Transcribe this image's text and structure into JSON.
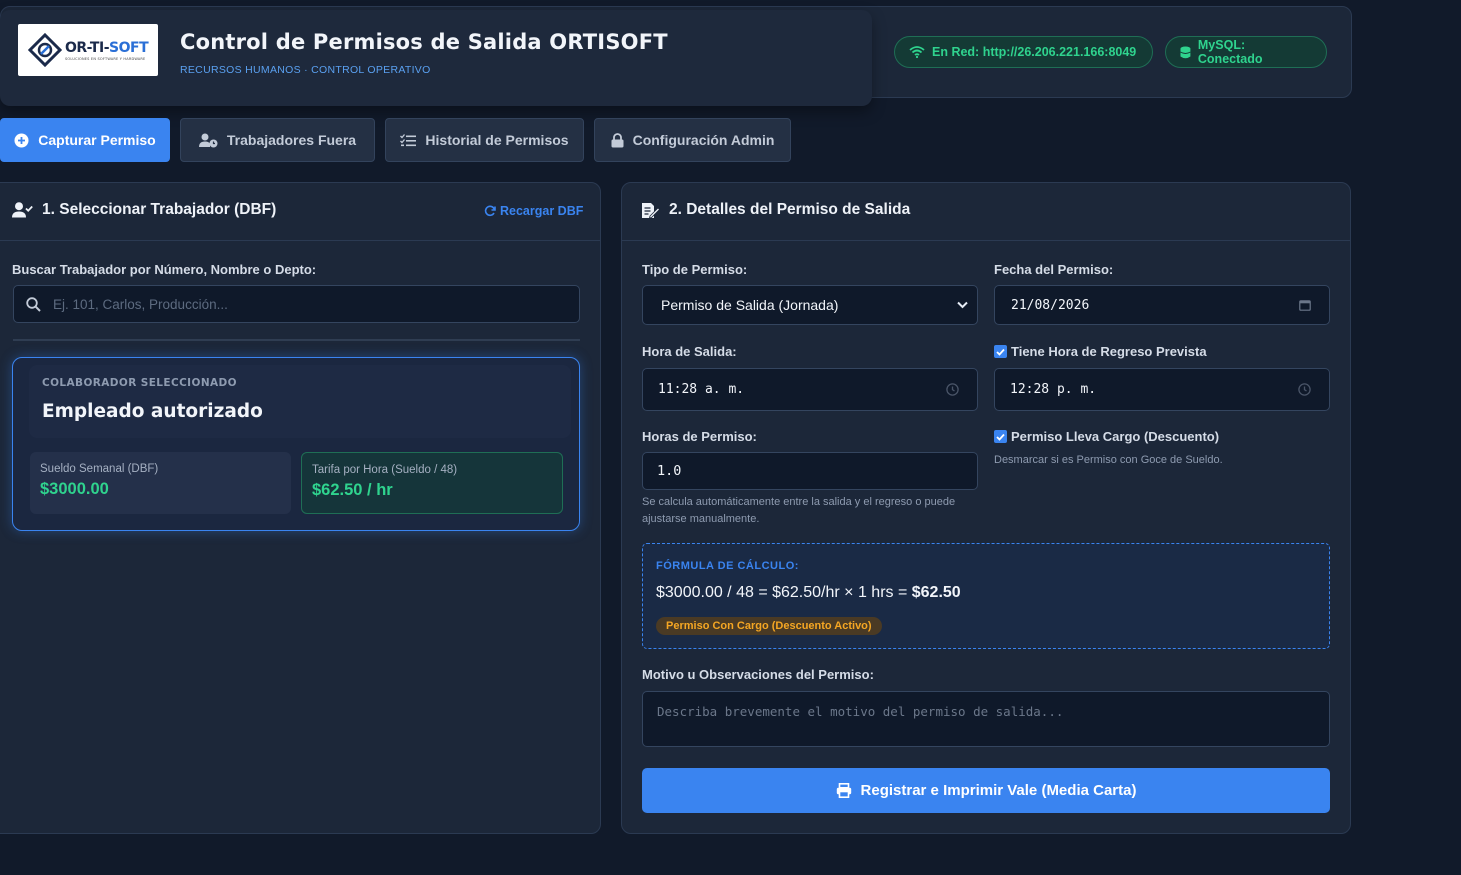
{
  "header": {
    "logo_brand_a": "OR-TI-",
    "logo_brand_b": "SOFT",
    "logo_tagline": "SOLUCIONES EN SOFTWARE Y HARDWARE",
    "title": "Control de Permisos de Salida ORTISOFT",
    "subtitle": "RECURSOS HUMANOS · CONTROL OPERATIVO",
    "network_status": "En Red: http://26.206.221.166:8049",
    "db_status": "MySQL: Conectado"
  },
  "tabs": [
    {
      "label": "Capturar Permiso",
      "icon": "plus-circle-icon",
      "active": true
    },
    {
      "label": "Trabajadores Fuera",
      "icon": "user-clock-icon",
      "active": false
    },
    {
      "label": "Historial de Permisos",
      "icon": "list-check-icon",
      "active": false
    },
    {
      "label": "Configuración Admin",
      "icon": "lock-icon",
      "active": false
    }
  ],
  "left_panel": {
    "title": "1. Seleccionar Trabajador (DBF)",
    "reload_label": "Recargar DBF",
    "search_label": "Buscar Trabajador por Número, Nombre o Depto:",
    "search_placeholder": "Ej. 101, Carlos, Producción...",
    "selected_caption": "COLABORADOR SELECCIONADO",
    "selected_name": "Empleado autorizado",
    "weekly_salary_label": "Sueldo Semanal (DBF)",
    "weekly_salary_value": "$3000.00",
    "hourly_rate_label": "Tarifa por Hora (Sueldo / 48)",
    "hourly_rate_value": "$62.50 / hr"
  },
  "right_panel": {
    "title": "2. Detalles del Permiso de Salida",
    "tipo_label": "Tipo de Permiso:",
    "tipo_value": "Permiso de Salida (Jornada)",
    "fecha_label": "Fecha del Permiso:",
    "fecha_value": "21/08/2026",
    "hora_salida_label": "Hora de Salida:",
    "hora_salida_value": "11:28 a. m.",
    "regreso_checkbox_label": "Tiene Hora de Regreso Prevista",
    "regreso_checked": true,
    "hora_regreso_value": "12:28 p. m.",
    "horas_label": "Horas de Permiso:",
    "horas_value": "1.0",
    "horas_help": "Se calcula automáticamente entre la salida y el regreso o puede ajustarse manualmente.",
    "cargo_checkbox_label": "Permiso Lleva Cargo (Descuento)",
    "cargo_checked": true,
    "cargo_help": "Desmarcar si es Permiso con Goce de Sueldo.",
    "formula_caption": "FÓRMULA DE CÁLCULO:",
    "formula_text": "$3000.00 / 48 = $62.50/hr × 1 hrs = ",
    "formula_result": "$62.50",
    "formula_badge": "Permiso Con Cargo (Descuento Activo)",
    "motivo_label": "Motivo u Observaciones del Permiso:",
    "motivo_placeholder": "Describa brevemente el motivo del permiso de salida...",
    "submit_label": "Registrar e Imprimir Vale (Media Carta)"
  },
  "colors": {
    "accent": "#3a84f0",
    "success": "#2fd38e",
    "warning": "#f5a623",
    "background": "#111a2a",
    "panel": "#1c2739"
  }
}
